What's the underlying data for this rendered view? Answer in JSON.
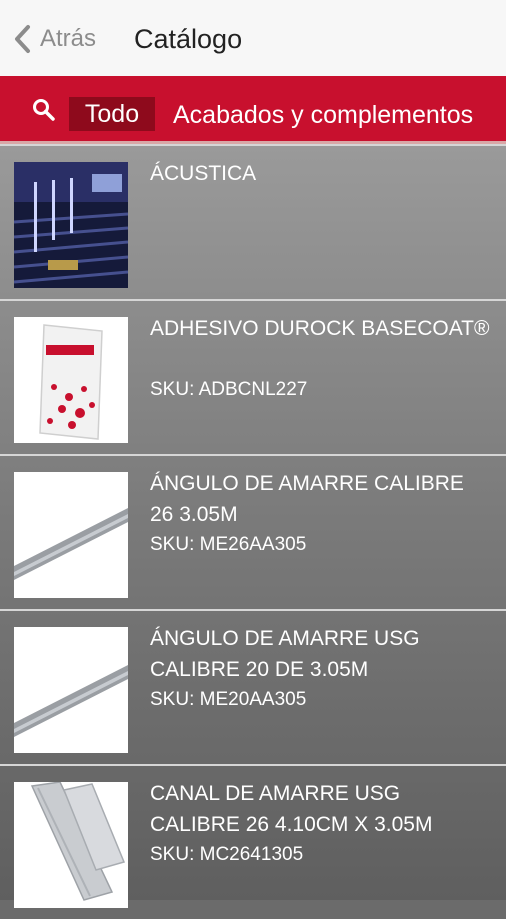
{
  "header": {
    "back_label": "Atrás",
    "title": "Catálogo"
  },
  "filters": {
    "tabs": [
      {
        "label": "Todo",
        "active": true
      },
      {
        "label": "Acabados y complementos",
        "active": false
      }
    ],
    "accent_color": "#c8102e"
  },
  "products": [
    {
      "name": "ÁCUSTICA",
      "sku": ""
    },
    {
      "name": "ADHESIVO DUROCK BASECOAT®",
      "sku": "SKU: ADBCNL227"
    },
    {
      "name": "ÁNGULO DE AMARRE CALIBRE 26 3.05M",
      "sku": "SKU: ME26AA305"
    },
    {
      "name": "ÁNGULO DE AMARRE USG CALIBRE 20 DE 3.05M",
      "sku": "SKU: ME20AA305"
    },
    {
      "name": "CANAL DE AMARRE USG CALIBRE 26 4.10CM X 3.05M",
      "sku": "SKU: MC2641305"
    }
  ]
}
